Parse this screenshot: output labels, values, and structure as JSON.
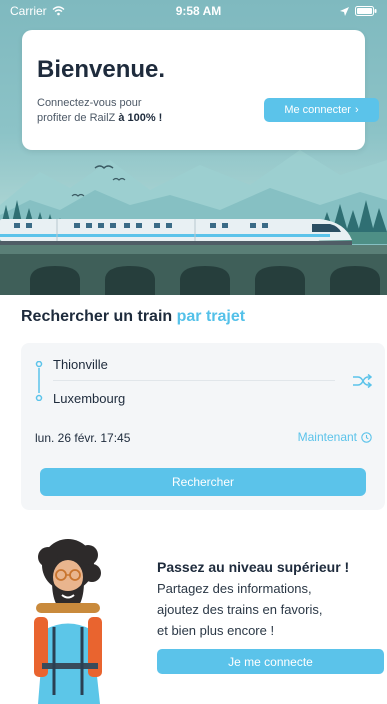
{
  "status_bar": {
    "carrier": "Carrier",
    "time": "9:58 AM"
  },
  "welcome": {
    "title": "Bienvenue.",
    "text_line1": "Connectez-vous pour",
    "text_line2_prefix": "profiter de RailZ ",
    "text_line2_bold": "à 100% !",
    "connect_label": "Me connecter",
    "connect_chevron": "›"
  },
  "search": {
    "title": "Rechercher un train",
    "title_accent": "par trajet",
    "from": "Thionville",
    "to": "Luxembourg",
    "date": "lun. 26 févr. 17:45",
    "now_label": "Maintenant",
    "button_label": "Rechercher"
  },
  "promo": {
    "title": "Passez au niveau supérieur !",
    "lines": [
      "Partagez des informations,",
      "ajoutez des trains en favoris,",
      "et bien plus encore !"
    ],
    "button_label": "Je me connecte"
  },
  "icons": {
    "wifi": "wifi-icon",
    "location": "location-arrow-icon",
    "battery": "battery-icon",
    "swap": "swap-icon",
    "clock": "clock-icon"
  },
  "colors": {
    "accent": "#5bc3ea",
    "title_text": "#1e2b3c"
  }
}
